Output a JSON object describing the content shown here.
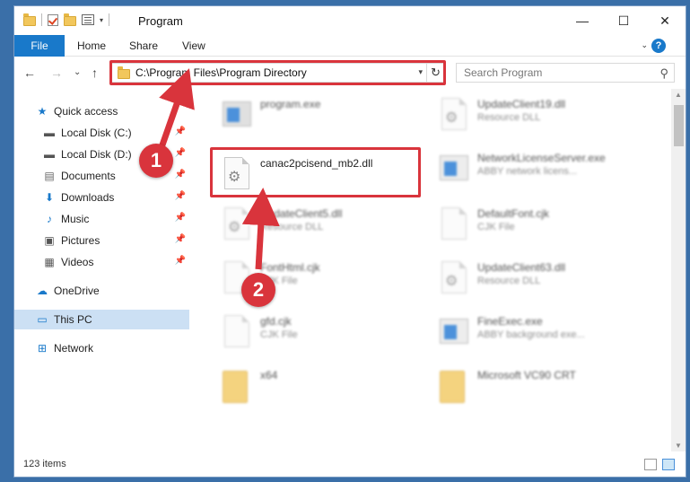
{
  "window": {
    "title": "Program",
    "controls": {
      "minimize": "—",
      "maximize": "☐",
      "close": "✕"
    }
  },
  "ribbon": {
    "tabs": [
      {
        "label": "File",
        "active": true
      },
      {
        "label": "Home"
      },
      {
        "label": "Share"
      },
      {
        "label": "View"
      }
    ],
    "help": "?"
  },
  "navigation": {
    "back": "←",
    "forward": "→",
    "recent": "⌄",
    "up": "↑",
    "address": "C:\\Program Files\\Program Directory",
    "refresh": "↻",
    "search_placeholder": "Search Program"
  },
  "nav_pane": {
    "items": [
      {
        "label": "Quick access",
        "icon": "star-icon",
        "glyph": "★",
        "color": "#1979ca"
      },
      {
        "label": "Local Disk (C:)",
        "icon": "drive-icon",
        "glyph": "▬",
        "color": "#555555",
        "pinned": true
      },
      {
        "label": "Local Disk (D:)",
        "icon": "drive-icon",
        "glyph": "▬",
        "color": "#555555",
        "pinned": true
      },
      {
        "label": "Documents",
        "icon": "documents-icon",
        "glyph": "▤",
        "color": "#666666",
        "pinned": true
      },
      {
        "label": "Downloads",
        "icon": "downloads-icon",
        "glyph": "⬇",
        "color": "#1979ca",
        "pinned": true
      },
      {
        "label": "Music",
        "icon": "music-icon",
        "glyph": "♪",
        "color": "#1979ca",
        "pinned": true
      },
      {
        "label": "Pictures",
        "icon": "pictures-icon",
        "glyph": "▣",
        "color": "#555555",
        "pinned": true
      },
      {
        "label": "Videos",
        "icon": "videos-icon",
        "glyph": "▦",
        "color": "#555555",
        "pinned": true
      },
      {
        "label": "OneDrive",
        "icon": "onedrive-icon",
        "glyph": "☁",
        "color": "#1979ca"
      },
      {
        "label": "This PC",
        "icon": "this-pc-icon",
        "glyph": "▭",
        "color": "#1979ca",
        "selected": true
      },
      {
        "label": "Network",
        "icon": "network-icon",
        "glyph": "⊞",
        "color": "#1979ca"
      }
    ]
  },
  "files": [
    {
      "name": "program.exe",
      "type": "",
      "icon": "program-icon",
      "blurred": true
    },
    {
      "name": "UpdateClient19.dll",
      "type": "Resource DLL",
      "icon": "dll-icon",
      "blurred": true
    },
    {
      "name": "canac2pcisend_mb2.dll",
      "type": "",
      "icon": "dll-icon",
      "blurred": false
    },
    {
      "name": "NetworkLicenseServer.exe",
      "type": "ABBY network licens...",
      "icon": "exe-icon",
      "blurred": true
    },
    {
      "name": "UpdateClient5.dll",
      "type": "Resource DLL",
      "icon": "dll-icon",
      "blurred": true
    },
    {
      "name": "DefaultFont.cjk",
      "type": "CJK File",
      "icon": "file-icon",
      "blurred": true
    },
    {
      "name": "FontHtml.cjk",
      "type": "CJK File",
      "icon": "file-icon",
      "blurred": true
    },
    {
      "name": "UpdateClient63.dll",
      "type": "Resource DLL",
      "icon": "dll-icon",
      "blurred": true
    },
    {
      "name": "gfd.cjk",
      "type": "CJK File",
      "icon": "file-icon",
      "blurred": true
    },
    {
      "name": "FineExec.exe",
      "type": "ABBY background exe...",
      "icon": "exe-icon",
      "blurred": true
    },
    {
      "name": "x64",
      "type": "",
      "icon": "folder-icon",
      "blurred": true
    },
    {
      "name": "Microsoft VC90 CRT",
      "type": "",
      "icon": "folder-icon",
      "blurred": true
    }
  ],
  "status": {
    "item_count": "123 items"
  },
  "annotations": {
    "step1": "1",
    "step2": "2",
    "color": "#d9343c"
  }
}
